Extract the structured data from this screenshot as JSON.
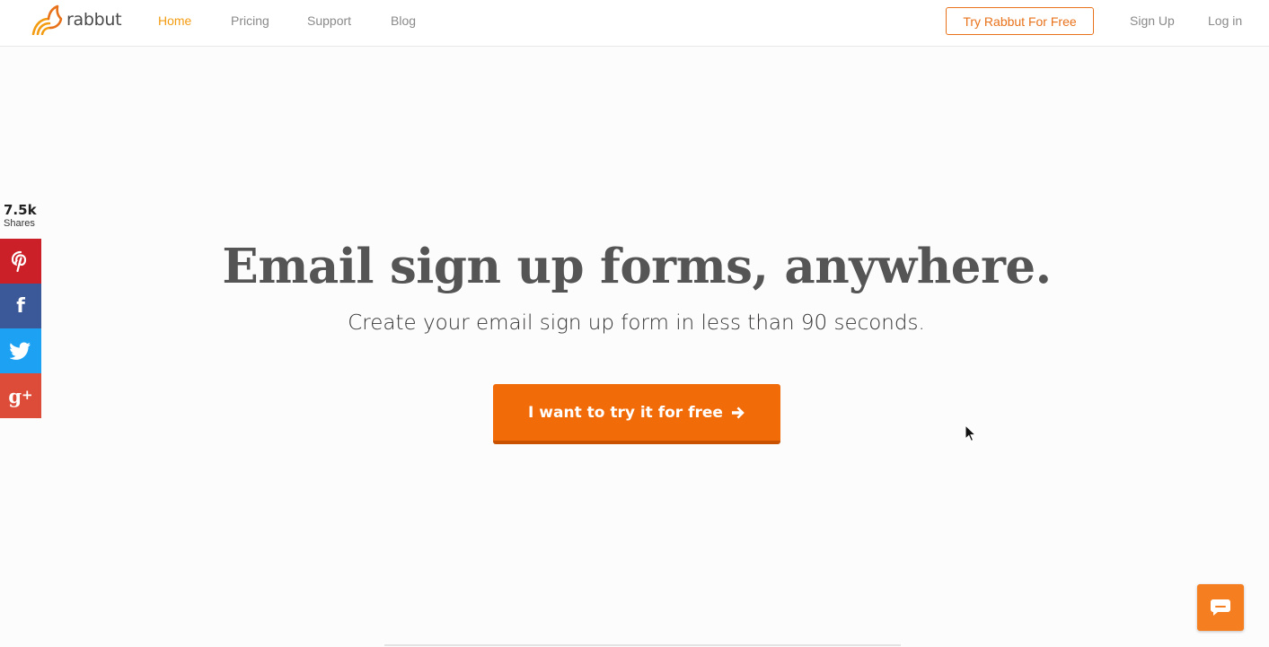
{
  "header": {
    "logo_text": "rabbut",
    "nav": [
      "Home",
      "Pricing",
      "Support",
      "Blog"
    ],
    "active_nav": "Home",
    "cta_label": "Try Rabbut For Free",
    "signup_label": "Sign Up",
    "login_label": "Log in"
  },
  "share": {
    "count": "7.5k",
    "label": "Shares",
    "networks": [
      "pinterest-icon",
      "facebook-icon",
      "twitter-icon",
      "google-plus-icon"
    ]
  },
  "hero": {
    "title": "Email sign up forms, anywhere.",
    "subtitle": "Create your email sign up form in less than 90 seconds.",
    "cta_label": "I want to try it for free"
  },
  "colors": {
    "accent": "#f16b09",
    "nav_active": "#f39c12",
    "pinterest": "#cb2027",
    "facebook": "#3b5998",
    "twitter": "#1da1f2",
    "google_plus": "#dd4b39"
  }
}
